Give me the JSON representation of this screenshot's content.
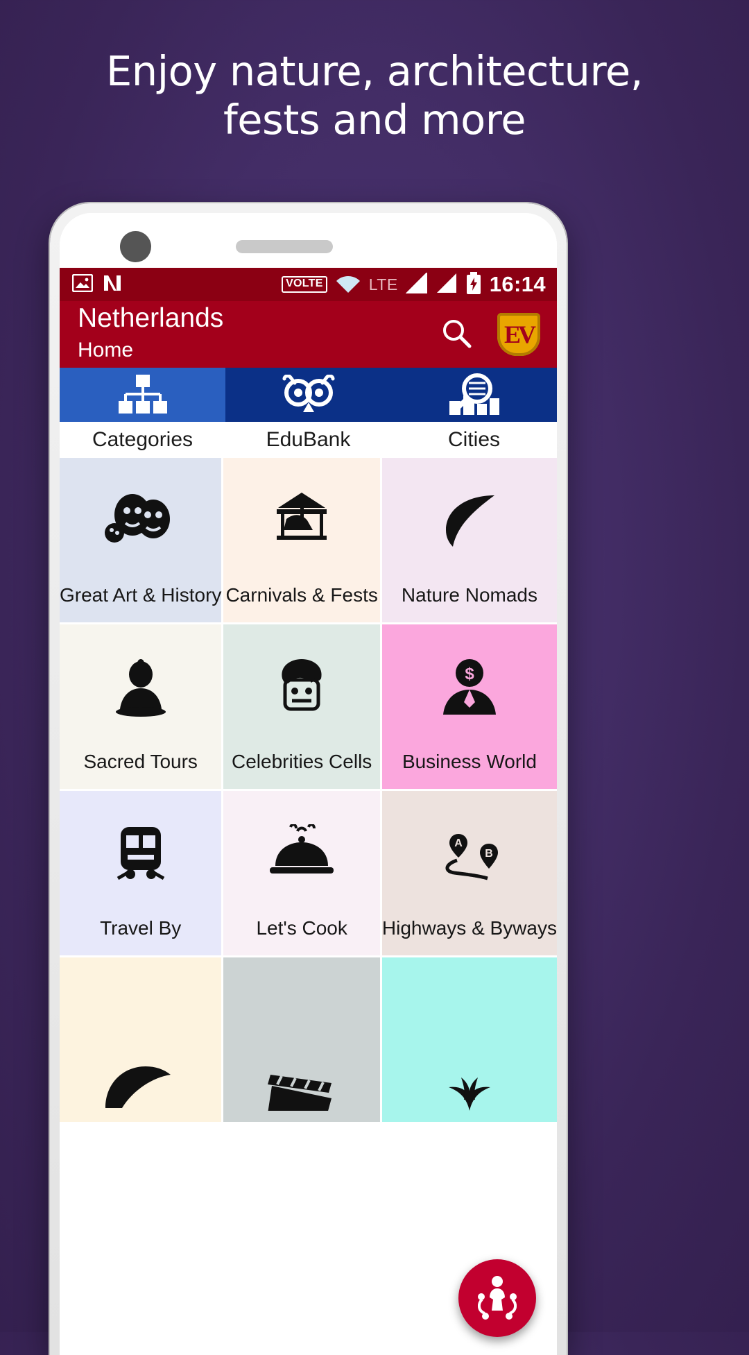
{
  "promo": {
    "headline_line1": "Enjoy nature, architecture,",
    "headline_line2": "fests and more"
  },
  "statusbar": {
    "icons": [
      "image-icon",
      "no-signal-icon"
    ],
    "volte_label": "VOLTE",
    "wifi_icon": "wifi-icon",
    "lte_label": "LTE",
    "signal_icons": [
      "signal-bars-icon",
      "signal-bars-icon"
    ],
    "battery_icon": "battery-charging-icon",
    "clock": "16:14"
  },
  "appbar": {
    "title": "Netherlands",
    "subtitle": "Home",
    "search_icon": "search-icon",
    "logo_text": "EV",
    "logo_icon": "shield-logo-icon",
    "accent_color": "#a3001b",
    "statusbar_color": "#8b0013"
  },
  "tabs": [
    {
      "label": "Categories",
      "icon": "sitemap-icon",
      "selected": true
    },
    {
      "label": "EduBank",
      "icon": "owl-icon",
      "selected": false
    },
    {
      "label": "Cities",
      "icon": "city-search-icon",
      "selected": false
    }
  ],
  "grid": {
    "items": [
      {
        "label": "Great Art & History",
        "icon": "theatre-masks-icon",
        "bg": "#dde3f0"
      },
      {
        "label": "Carnivals & Fests",
        "icon": "carousel-icon",
        "bg": "#fdf1e7"
      },
      {
        "label": "Nature Nomads",
        "icon": "leaf-icon",
        "bg": "#f3e6f2"
      },
      {
        "label": "Sacred Tours",
        "icon": "buddha-icon",
        "bg": "#f7f5ee"
      },
      {
        "label": "Celebrities Cells",
        "icon": "celebrity-face-icon",
        "bg": "#dfeae5"
      },
      {
        "label": "Business World",
        "icon": "businessman-icon",
        "bg": "#fba7dd"
      },
      {
        "label": "Travel By",
        "icon": "train-icon",
        "bg": "#e7e8fa"
      },
      {
        "label": "Let's Cook",
        "icon": "cloche-icon",
        "bg": "#f9f0f6"
      },
      {
        "label": "Highways & Byways",
        "icon": "route-a-b-icon",
        "bg": "#ede2de"
      },
      {
        "label": "",
        "icon": "hand-fan-icon",
        "bg": "#fdf3df"
      },
      {
        "label": "",
        "icon": "film-clapper-icon",
        "bg": "#ccd3d3"
      },
      {
        "label": "",
        "icon": "sparkle-plant-icon",
        "bg": "#a7f5ec"
      }
    ]
  },
  "fab": {
    "icon": "guide-person-icon",
    "color": "#c2002f"
  }
}
